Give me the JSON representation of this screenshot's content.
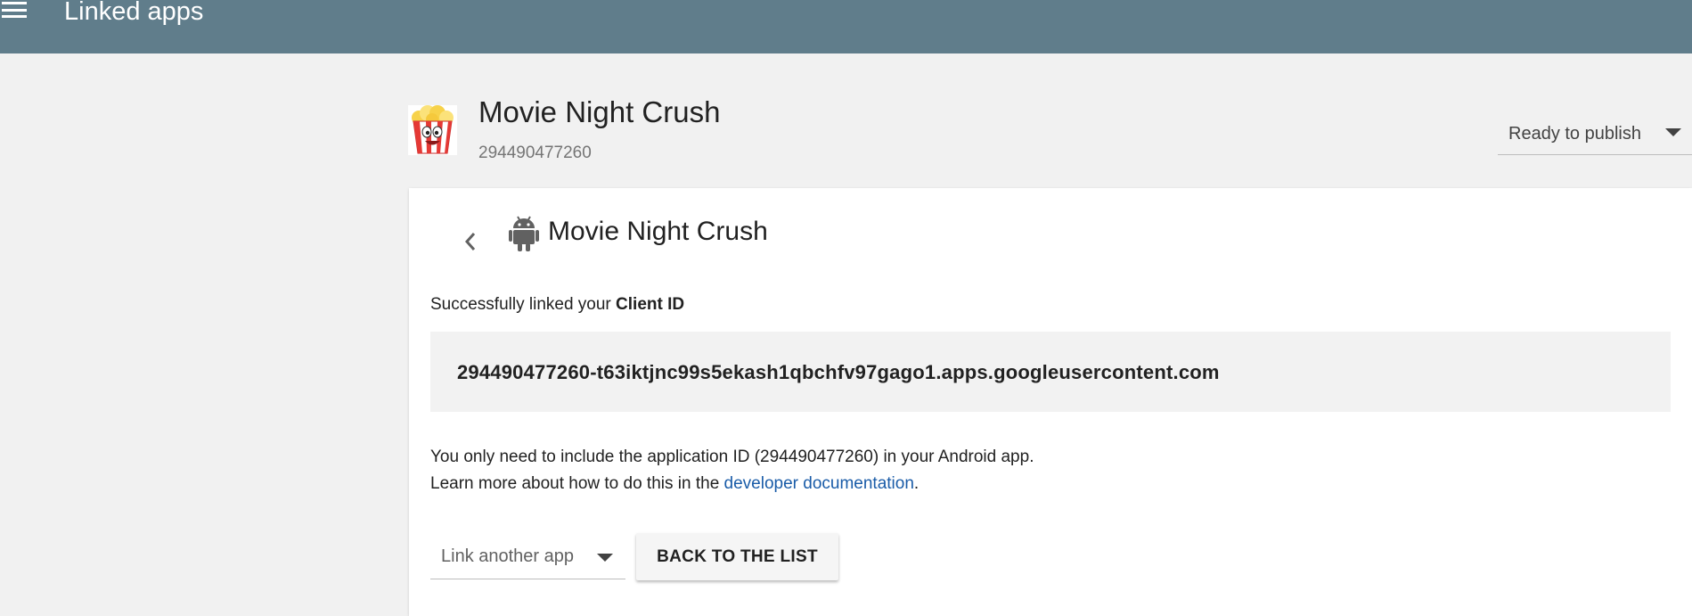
{
  "header": {
    "title": "Linked apps",
    "menu_icon": "hamburger-menu-icon",
    "background_color": "#607d8b"
  },
  "app": {
    "name": "Movie Night Crush",
    "id": "294490477260",
    "logo_icon": "popcorn-bucket-icon"
  },
  "publish_status": {
    "selected": "Ready to publish"
  },
  "detail": {
    "back_icon": "chevron-left-icon",
    "platform_icon": "android-icon",
    "title": "Movie Night Crush",
    "success_prefix": "Successfully linked your ",
    "success_bold": "Client ID",
    "client_id": "294490477260-t63iktjnc99s5ekash1qbchfv97gago1.apps.googleusercontent.com",
    "info_line1": "You only need to include the application ID (294490477260) in your Android app.",
    "info_line2_prefix": "Learn more about how to do this in the ",
    "doc_link": "developer documentation",
    "info_line2_suffix": ".",
    "link_color": "#1a5ca8"
  },
  "actions": {
    "link_another_label": "Link another app",
    "back_to_list_label": "BACK TO THE LIST"
  }
}
